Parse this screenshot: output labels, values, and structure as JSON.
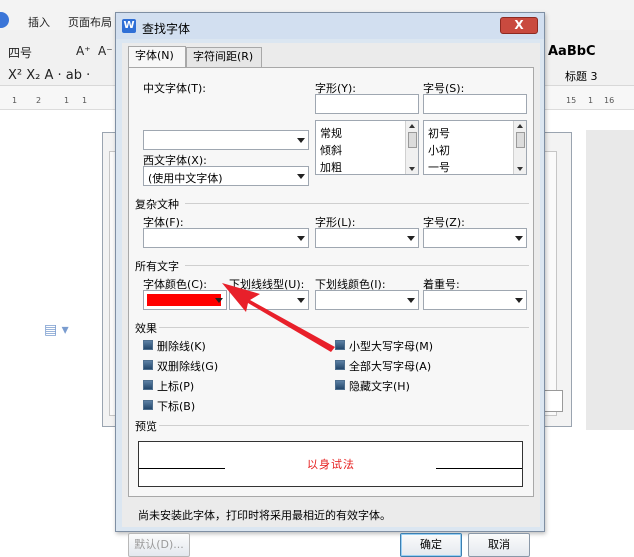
{
  "background_app": {
    "menu": [
      "插入",
      "页面布局"
    ],
    "toolbar_row1": [
      "四号",
      "A⁺",
      "A⁻"
    ],
    "style_preview": "AaBbC",
    "style_name": "标题 3",
    "ruler_ticks": [
      "1",
      "2",
      "1",
      "1",
      "15",
      "1",
      "16"
    ]
  },
  "dialog": {
    "title": "查找字体",
    "close_label": "X",
    "tabs": [
      {
        "label": "字体(N)",
        "active": true
      },
      {
        "label": "字符间距(R)",
        "active": false
      }
    ],
    "cjk_font_label": "中文字体(T):",
    "cjk_font_value": "",
    "style_label": "字形(Y):",
    "style_value": "",
    "style_options": [
      "常规",
      "倾斜",
      "加粗"
    ],
    "size_label": "字号(S):",
    "size_value": "",
    "size_options": [
      "初号",
      "小初",
      "一号"
    ],
    "western_font_label": "西文字体(X):",
    "western_font_value": "(使用中文字体)",
    "complex_group": "复杂文种",
    "complex_font_label": "字体(F):",
    "complex_style_label": "字形(L):",
    "complex_size_label": "字号(Z):",
    "all_text_group": "所有文字",
    "font_color_label": "字体颜色(C):",
    "font_color_value": "#ff0000",
    "underline_type_label": "下划线线型(U):",
    "underline_color_label": "下划线颜色(I):",
    "emphasis_label": "着重号:",
    "effects_group": "效果",
    "effects": [
      {
        "label": "删除线(K)"
      },
      {
        "label": "双删除线(G)"
      },
      {
        "label": "上标(P)"
      },
      {
        "label": "下标(B)"
      },
      {
        "label": "小型大写字母(M)"
      },
      {
        "label": "全部大写字母(A)"
      },
      {
        "label": "隐藏文字(H)"
      }
    ],
    "preview_group": "预览",
    "preview_text": "以身试法",
    "note": "尚未安装此字体，打印时将采用最相近的有效字体。",
    "buttons": {
      "default": "默认(D)...",
      "ok": "确定",
      "cancel": "取消"
    }
  },
  "colors": {
    "accent_red": "#ff0000",
    "arrow_red": "#e8202a",
    "preview_text": "#e61d1d"
  }
}
